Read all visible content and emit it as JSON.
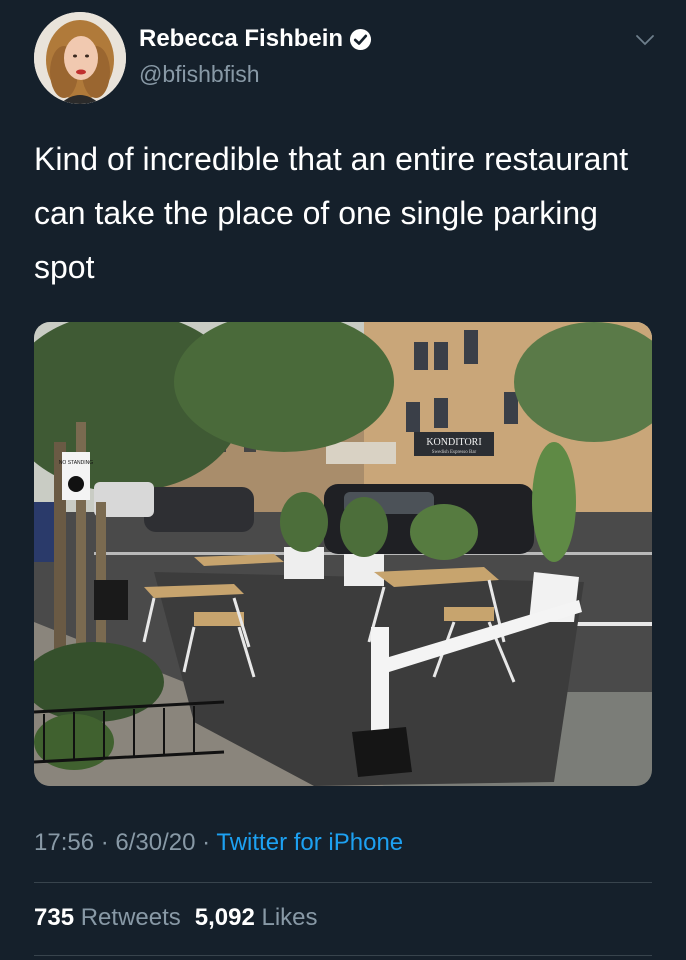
{
  "user": {
    "display_name": "Rebecca Fishbein",
    "handle": "@bfishbfish",
    "verified": true
  },
  "tweet": {
    "text": "Kind of incredible that an entire restaurant can take the place of one single parking spot"
  },
  "media": {
    "signs": {
      "shop1": "KONDITORI",
      "shop1_sub": "Swedish Espresso Bar",
      "parking_sign": "NO STANDING"
    }
  },
  "meta": {
    "time": "17:56",
    "separator": "·",
    "date": "6/30/20",
    "source": "Twitter for iPhone"
  },
  "stats": {
    "retweets_count": "735",
    "retweets_label": "Retweets",
    "likes_count": "5,092",
    "likes_label": "Likes"
  },
  "colors": {
    "background": "#15202b",
    "secondary_text": "#8899a6",
    "link": "#1da1f2",
    "divider": "#38444d"
  },
  "icons": [
    "verified-badge-icon",
    "chevron-down-icon"
  ]
}
